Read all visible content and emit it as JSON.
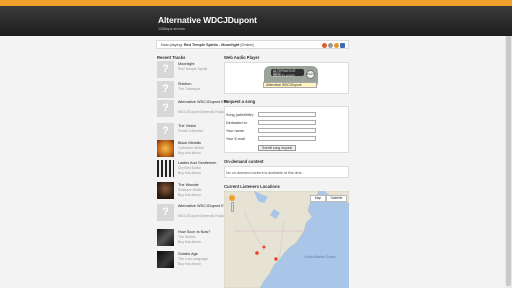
{
  "header": {
    "title": "Alternative WDCJDupont",
    "subtitle": "128kbps stream"
  },
  "now_playing": {
    "prefix": "Now playing:",
    "track": "Red Temple Spirits - Moonlight",
    "suffix": "[Online]"
  },
  "recent": {
    "heading": "Recent Tracks",
    "items": [
      {
        "title": "Moonlight",
        "artist": "Red Temple Spirits",
        "extra": ""
      },
      {
        "title": "Shiction",
        "artist": "The Tubesque",
        "extra": ""
      },
      {
        "title": "Alternative WDCJDupont ESL",
        "artist": "WDCJDupont (Internal) Radio",
        "extra": ""
      },
      {
        "title": "The Visitor",
        "artist": "Fossil Collective",
        "extra": ""
      },
      {
        "title": "Black Metallic",
        "artist": "Catherine Wheel",
        "extra": "Buy this album"
      },
      {
        "title": "Ladies And Gentlemen",
        "artist": "Dry Bed Sulfur",
        "extra": "Buy this album"
      },
      {
        "title": "The Wonder",
        "artist": "Shabazz Wolfe",
        "extra": "Buy this album"
      },
      {
        "title": "Alternative WDCJDupont ESL",
        "artist": "WDCJDupont (Internal) Radio",
        "extra": ""
      },
      {
        "title": "How Soon Is Now?",
        "artist": "The Smiths",
        "extra": "Buy this album"
      },
      {
        "title": "Golden Age",
        "artist": "The Lost Language",
        "extra": "Buy this album"
      }
    ]
  },
  "web_player": {
    "heading": "Web Audio Player",
    "screen_line1": "ALTERNATIVE WDC",
    "screen_line2": "WEB PLAYER",
    "play_label": "PLAY",
    "station": "Alternative WDCJDupont"
  },
  "request": {
    "heading": "Request a song",
    "fields": [
      {
        "label": "Song (artist/title):"
      },
      {
        "label": "Dedicated to:"
      },
      {
        "label": "Your name:"
      },
      {
        "label": "Your E-mail:"
      }
    ],
    "submit_label": "Submit song request"
  },
  "on_demand": {
    "heading": "On-demand content",
    "message": "No on-demand content is available at this time."
  },
  "listeners": {
    "heading": "Current Listeners Locations",
    "map_button": "Map",
    "satellite_button": "Satellite",
    "ocean_label": "North Atlantic Ocean"
  },
  "colors": {
    "accent": "#f0a12a",
    "header_bg": "#2a2a2a"
  }
}
